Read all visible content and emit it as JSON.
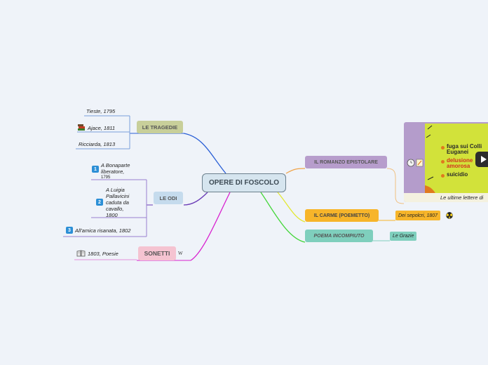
{
  "center": {
    "label": "OPERE DI FOSCOLO"
  },
  "branches": {
    "tragedie": {
      "label": "LE TRAGEDIE",
      "color": "#c8cf9a",
      "line": "#2a5fd6",
      "items": [
        "Tieste, 1795",
        "Ajace, 1811",
        "Ricciarda, 1813"
      ]
    },
    "odi": {
      "label": "LE ODI",
      "color": "#c5dbed",
      "line": "#6a3bb6",
      "items": [
        {
          "num": "1",
          "lines": [
            "A Bonaparte",
            "liberatore,"
          ],
          "small": "1795"
        },
        {
          "num": "2",
          "lines": [
            "A Luigia",
            "Pallavicini",
            "caduta da",
            "cavallo,",
            "1800"
          ]
        },
        {
          "num": "3",
          "lines": [
            "All'amica risanata, 1802"
          ]
        }
      ]
    },
    "sonetti": {
      "label": "SONETTI",
      "color": "#f5c3d1",
      "line": "#d81fcf",
      "suffix": "W",
      "items": [
        "1803, Poesie"
      ]
    },
    "romanzo": {
      "label": "IL ROMANZO EPISTOLARE",
      "color": "#b79dcc",
      "line": "#f0a44a",
      "video": {
        "lines": [
          "fuga sui Colli",
          "Euganei",
          "delusione",
          "amorosa",
          "suicidio"
        ],
        "caption": "Le ultime lettere di"
      }
    },
    "carme": {
      "label": "IL CARME (POEMETTO)",
      "color": "#f7b52a",
      "line": "#e3e830",
      "items": [
        "Dei sepolcri, 1807"
      ]
    },
    "poema": {
      "label": "POEMA INCOMPIUTO",
      "color": "#7fcfbd",
      "line": "#44d63a",
      "items": [
        "Le Grazie"
      ]
    }
  },
  "icons": [
    "books-icon",
    "book-icon",
    "notes-icon",
    "clock-icon",
    "play-icon",
    "radiation-icon"
  ]
}
